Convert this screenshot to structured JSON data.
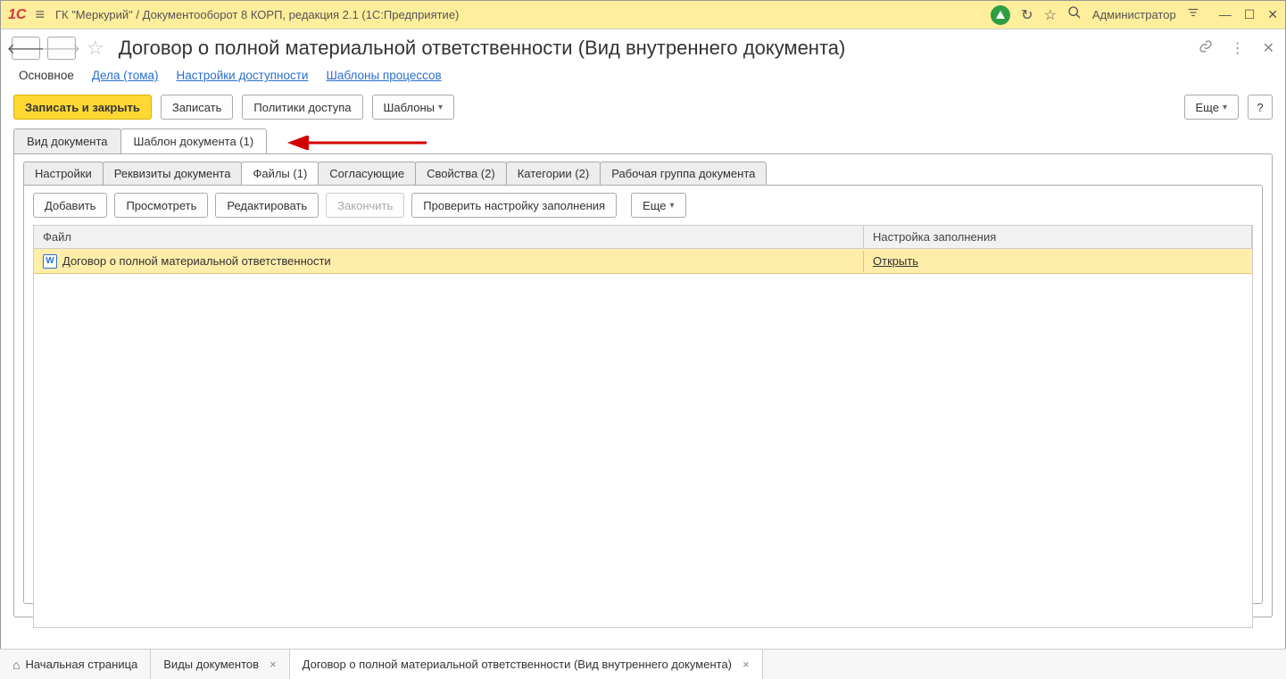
{
  "titlebar": {
    "app_title": "ГК \"Меркурий\" / Документооборот 8 КОРП, редакция 2.1  (1С:Предприятие)",
    "user": "Администратор"
  },
  "form": {
    "title": "Договор о полной материальной ответственности (Вид внутреннего документа)"
  },
  "nav_links": [
    "Основное",
    "Дела (тома)",
    "Настройки доступности",
    "Шаблоны процессов"
  ],
  "cmd_bar": {
    "save_close": "Записать и закрыть",
    "save": "Записать",
    "access_policies": "Политики доступа",
    "templates": "Шаблоны",
    "more": "Еще",
    "help": "?"
  },
  "top_tabs": [
    "Вид документа",
    "Шаблон документа (1)"
  ],
  "sub_tabs": [
    "Настройки",
    "Реквизиты документа",
    "Файлы (1)",
    "Согласующие",
    "Свойства (2)",
    "Категории (2)",
    "Рабочая группа документа"
  ],
  "file_toolbar": {
    "add": "Добавить",
    "view": "Просмотреть",
    "edit": "Редактировать",
    "finish": "Закончить",
    "check_fill": "Проверить настройку заполнения",
    "more": "Еще"
  },
  "table": {
    "headers": {
      "file": "Файл",
      "fill_setting": "Настройка заполнения"
    },
    "row": {
      "filename": "Договор о полной материальной ответственности",
      "open": "Открыть"
    }
  },
  "taskbar": {
    "home": "Начальная страница",
    "tab1": "Виды документов",
    "tab2": "Договор о полной материальной ответственности (Вид внутреннего документа)"
  }
}
